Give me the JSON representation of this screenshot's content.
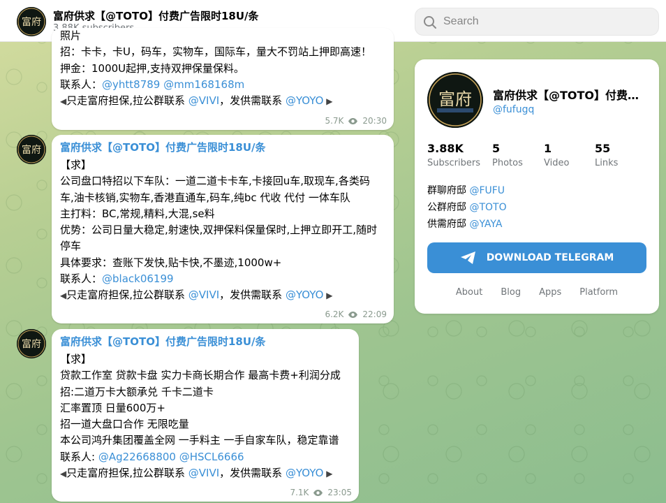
{
  "header": {
    "title": "富府供求【@TOTO】付费广告限时18U/条",
    "subscribers": "3.88K subscribers",
    "search_placeholder": "Search"
  },
  "avatar_text": "富府",
  "messages": [
    {
      "partial_top": "照片",
      "lines": [
        [
          {
            "t": "招：卡卡，卡U，码车，实物车，国际车，量大不罚站上押即高速！"
          }
        ],
        [
          {
            "t": "押金：1000U起押,支持双押保量保料。"
          }
        ],
        [
          {
            "t": "联系人："
          },
          {
            "t": "@yhtt8789",
            "link": true
          },
          {
            "t": " "
          },
          {
            "t": "@mm168168m",
            "link": true
          }
        ],
        [
          {
            "t": "◀",
            "arrow": true
          },
          {
            "t": "只走富府担保,拉公群联系 "
          },
          {
            "t": "@VIVI",
            "link": true
          },
          {
            "t": "，发供需联系 "
          },
          {
            "t": "@YOYO",
            "link": true
          },
          {
            "t": " ▶",
            "arrow": true
          }
        ]
      ],
      "views": "5.7K",
      "time": "20:30"
    },
    {
      "title": "富府供求【@TOTO】付费广告限时18U/条",
      "lines": [
        [
          {
            "t": "【求】"
          }
        ],
        [
          {
            "t": "公司盘口特招以下车队：一道二道卡卡车,卡接回u车,取现车,各类码"
          }
        ],
        [
          {
            "t": "车,油卡核销,实物车,香港直通车,码车,纯bc 代收 代付 一体车队"
          }
        ],
        [
          {
            "t": "主打料：BC,常规,精料,大混,se料"
          }
        ],
        [
          {
            "t": "优势：公司日量大稳定,射速快,双押保料保量保时,上押立即开工,随时"
          }
        ],
        [
          {
            "t": "停车"
          }
        ],
        [
          {
            "t": "具体要求：查账下发快,贴卡快,不墨迹,1000w+"
          }
        ],
        [
          {
            "t": "联系人："
          },
          {
            "t": "@black06199",
            "link": true
          }
        ],
        [
          {
            "t": "◀",
            "arrow": true
          },
          {
            "t": "只走富府担保,拉公群联系 "
          },
          {
            "t": "@VIVI",
            "link": true
          },
          {
            "t": "，发供需联系 "
          },
          {
            "t": "@YOYO",
            "link": true
          },
          {
            "t": " ▶",
            "arrow": true
          }
        ]
      ],
      "views": "6.2K",
      "time": "22:09"
    },
    {
      "title": "富府供求【@TOTO】付费广告限时18U/条",
      "lines": [
        [
          {
            "t": "【求】"
          }
        ],
        [
          {
            "t": "贷款工作室 贷款卡盘 实力卡商长期合作 最高卡费+利润分成"
          }
        ],
        [
          {
            "t": "招:二道万卡大额承兑 千卡二道卡"
          }
        ],
        [
          {
            "t": "汇率置顶 日量600万+"
          }
        ],
        [
          {
            "t": "招一道大盘口合作 无限吃量"
          }
        ],
        [
          {
            "t": "本公司鸿升集团覆盖全网 一手料主 一手自家车队，稳定靠谱"
          }
        ],
        [
          {
            "t": "联系人: "
          },
          {
            "t": "@Ag22668800",
            "link": true
          },
          {
            "t": " "
          },
          {
            "t": "@HSCL6666",
            "link": true
          }
        ],
        [
          {
            "t": "◀",
            "arrow": true
          },
          {
            "t": "只走富府担保,拉公群联系 "
          },
          {
            "t": "@VIVI",
            "link": true
          },
          {
            "t": "，发供需联系 "
          },
          {
            "t": "@YOYO",
            "link": true
          },
          {
            "t": " ▶",
            "arrow": true
          }
        ]
      ],
      "views": "7.1K",
      "time": "23:05"
    }
  ],
  "panel": {
    "title": "富府供求【@TOTO】付费广告限时18U/条",
    "handle": "@fufugq",
    "stats": [
      {
        "n": "3.88K",
        "l": "Subscribers"
      },
      {
        "n": "5",
        "l": "Photos"
      },
      {
        "n": "1",
        "l": "Video"
      },
      {
        "n": "55",
        "l": "Links"
      }
    ],
    "links": [
      {
        "label": "群聊府邸 ",
        "handle": "@FUFU"
      },
      {
        "label": "公群府邸 ",
        "handle": "@TOTO"
      },
      {
        "label": "供需府邸 ",
        "handle": "@YAYA"
      }
    ],
    "download_label": "DOWNLOAD TELEGRAM",
    "footer": [
      "About",
      "Blog",
      "Apps",
      "Platform"
    ]
  },
  "colors": {
    "accent": "#3a8fd6",
    "meta": "#8a9a8e"
  }
}
